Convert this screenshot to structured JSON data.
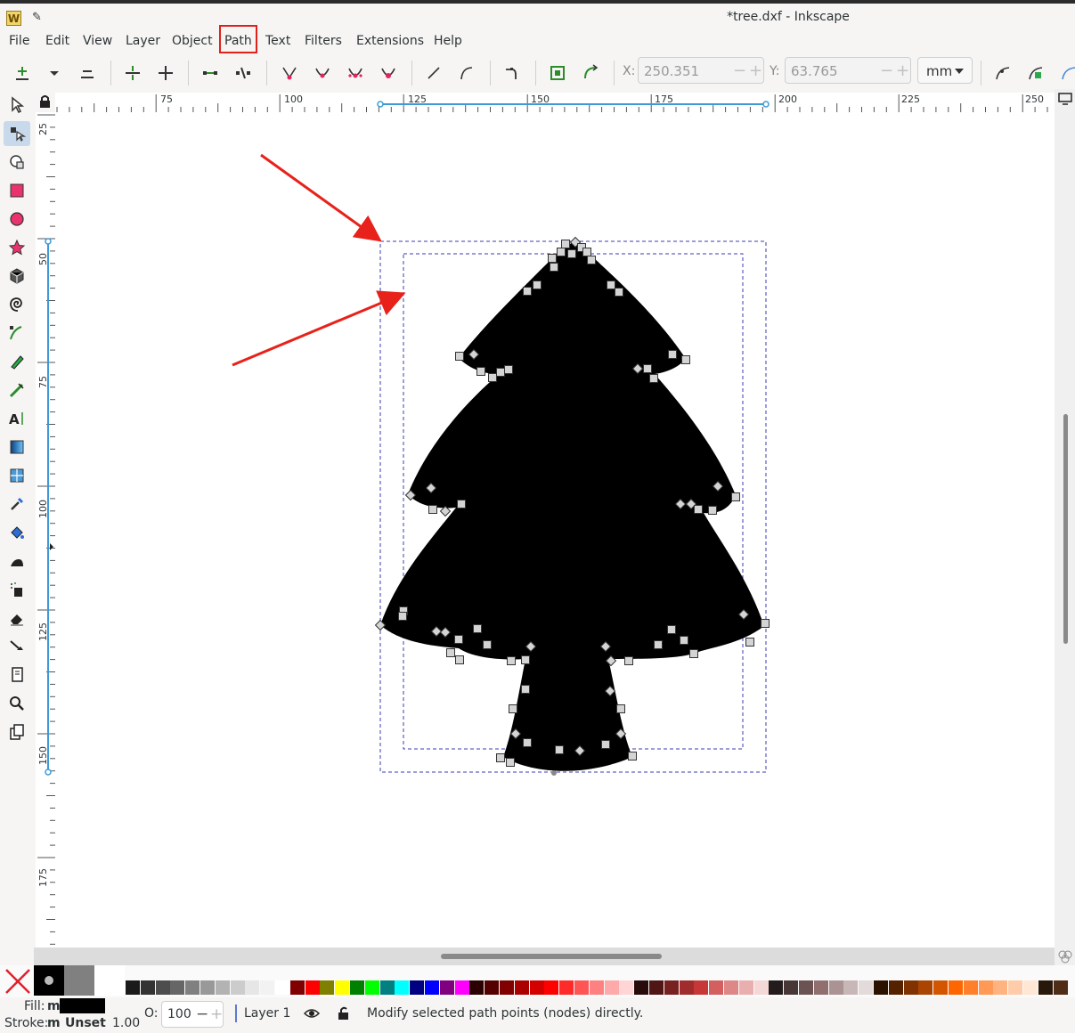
{
  "window": {
    "title": "*tree.dxf - Inkscape",
    "logo_letter": "W"
  },
  "menu": [
    {
      "id": "file",
      "label": "File"
    },
    {
      "id": "edit",
      "label": "Edit"
    },
    {
      "id": "view",
      "label": "View"
    },
    {
      "id": "layer",
      "label": "Layer"
    },
    {
      "id": "object",
      "label": "Object"
    },
    {
      "id": "path",
      "label": "Path"
    },
    {
      "id": "text",
      "label": "Text"
    },
    {
      "id": "filters",
      "label": "Filters"
    },
    {
      "id": "extensions",
      "label": "Extensions"
    },
    {
      "id": "help",
      "label": "Help"
    }
  ],
  "toolbar": {
    "x_label": "X:",
    "x_value": "250.351",
    "y_label": "Y:",
    "y_value": "63.765",
    "unit": "mm",
    "minus": "−",
    "plus": "+"
  },
  "ruler": {
    "horizontal_labels": [
      "75",
      "100",
      "125",
      "150",
      "175",
      "200",
      "225",
      "250"
    ],
    "vertical_labels": [
      "25",
      "50",
      "75",
      "100",
      "125",
      "150",
      "175"
    ]
  },
  "tools": [
    "selector-tool-icon",
    "node-tool-icon",
    "tweak-tool-icon",
    "rectangle-tool-icon",
    "ellipse-tool-icon",
    "star-tool-icon",
    "3dbox-tool-icon",
    "spiral-tool-icon",
    "pen-tool-icon",
    "pencil-tool-icon",
    "calligraphy-tool-icon",
    "text-tool-icon",
    "gradient-tool-icon",
    "mesh-tool-icon",
    "dropper-tool-icon",
    "paint-bucket-tool-icon",
    "tweak-brush-tool-icon",
    "spray-tool-icon",
    "eraser-tool-icon",
    "connector-tool-icon",
    "pages-tool-icon",
    "zoom-tool-icon",
    "clone-tool-icon"
  ],
  "palette": {
    "colors": [
      "#1a1a1a",
      "#333333",
      "#4d4d4d",
      "#666666",
      "#808080",
      "#999999",
      "#b3b3b3",
      "#cccccc",
      "#e6e6e6",
      "#f2f2f2",
      "#ffffff",
      "#800000",
      "#ff0000",
      "#808000",
      "#ffff00",
      "#008000",
      "#00ff00",
      "#008080",
      "#00ffff",
      "#000080",
      "#0000ff",
      "#800080",
      "#ff00ff",
      "#2b0000",
      "#550000",
      "#800000",
      "#aa0000",
      "#d40000",
      "#ff0000",
      "#ff2a2a",
      "#ff5555",
      "#ff8080",
      "#ffaaaa",
      "#ffd5d5",
      "#280b0b",
      "#501616",
      "#782121",
      "#a02c2c",
      "#c83737",
      "#d35f5f",
      "#de8787",
      "#e9afaf",
      "#f4d7d7",
      "#241c1c",
      "#483737",
      "#6c5353",
      "#916f6f",
      "#ac9393",
      "#c8b7b7",
      "#e3dbdb",
      "#2b1100",
      "#552200",
      "#803300",
      "#aa4400",
      "#d45500",
      "#ff6600",
      "#ff7f2a",
      "#ff9955",
      "#ffb380",
      "#ffccaa",
      "#ffe6d5",
      "#28170b",
      "#502d16"
    ]
  },
  "status": {
    "fill_label": "Fill:",
    "fill_value": "m",
    "stroke_label": "Stroke:",
    "stroke_value": "m",
    "stroke_unset": "Unset",
    "stroke_width": "1.00",
    "opacity_label": "O:",
    "opacity_value": "100",
    "layer_name": "Layer 1",
    "message": "Modify selected path points (nodes) directly."
  },
  "colors": {
    "annotation_red": "#e8211a",
    "guide_blue": "#3d9ad6",
    "selection_dash": "#3b3bb0"
  }
}
